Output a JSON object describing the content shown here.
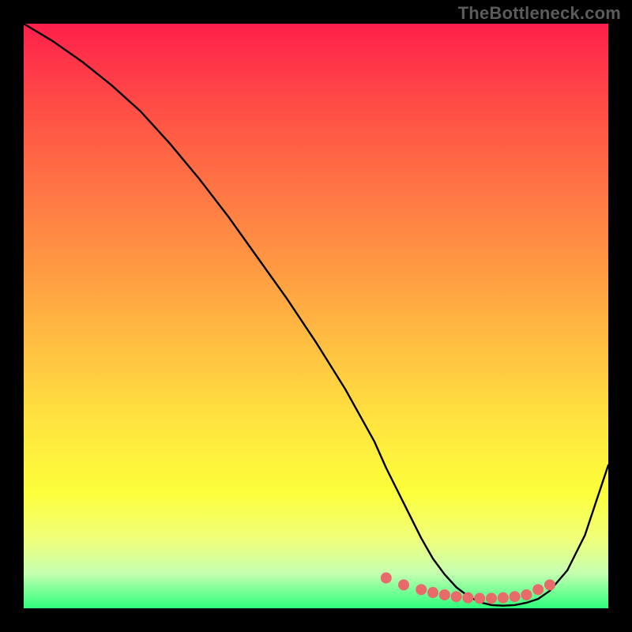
{
  "watermark": "TheBottleneck.com",
  "chart_data": {
    "type": "line",
    "title": "",
    "xlabel": "",
    "ylabel": "",
    "xlim": [
      0,
      100
    ],
    "ylim": [
      0,
      100
    ],
    "series": [
      {
        "name": "curve",
        "x": [
          0,
          5,
          10,
          15,
          20,
          25,
          30,
          35,
          40,
          45,
          50,
          55,
          60,
          62,
          65,
          68,
          70,
          72,
          74,
          76,
          78,
          80,
          82,
          84,
          86,
          88,
          90,
          93,
          96,
          100
        ],
        "y": [
          100,
          97,
          93.5,
          89.5,
          85,
          79.5,
          73.5,
          67,
          60,
          53,
          45.5,
          37.5,
          28.5,
          24,
          18,
          12,
          8.5,
          5.8,
          3.6,
          2.1,
          1.05,
          0.55,
          0.45,
          0.55,
          0.95,
          1.6,
          3.0,
          6.5,
          12.5,
          24.5
        ]
      },
      {
        "name": "highlight-dots",
        "x": [
          62,
          65,
          68,
          70,
          72,
          74,
          76,
          78,
          80,
          82,
          84,
          86,
          88,
          90
        ],
        "y": [
          5.2,
          4.0,
          3.2,
          2.7,
          2.3,
          2.0,
          1.8,
          1.7,
          1.7,
          1.8,
          2.0,
          2.3,
          3.2,
          4.0
        ]
      }
    ],
    "colors": {
      "curve": "#000000",
      "highlight": "#e86a6a",
      "gradient_top": "#ff1f4b",
      "gradient_bottom": "#2fff7c"
    }
  }
}
